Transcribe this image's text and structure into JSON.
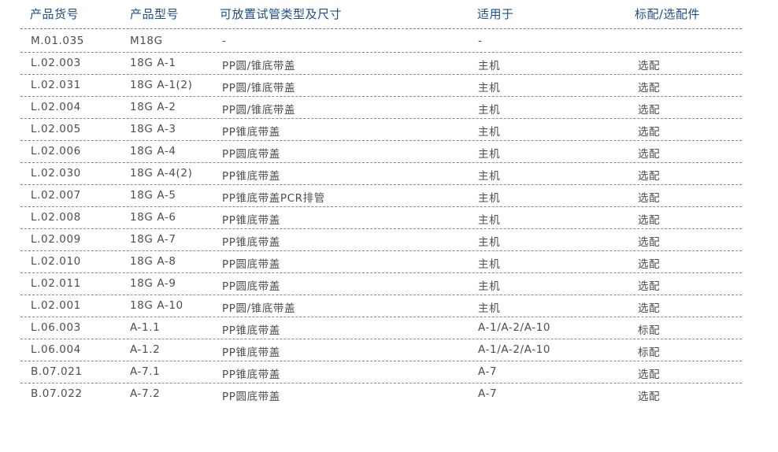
{
  "headers": {
    "code": "产品货号",
    "model": "产品型号",
    "tube": "可放置试管类型及尺寸",
    "applies_to": "适用于",
    "std_opt": "标配/选配件"
  },
  "rows": [
    {
      "code": "M.01.035",
      "model": "M18G",
      "tube": "-",
      "applies_to": "-",
      "std_opt": ""
    },
    {
      "code": "L.02.003",
      "model": "18G A-1",
      "tube": "PP圆/锥底带盖",
      "applies_to": "主机",
      "std_opt": "选配"
    },
    {
      "code": "L.02.031",
      "model": "18G A-1(2)",
      "tube": "PP圆/锥底带盖",
      "applies_to": "主机",
      "std_opt": "选配"
    },
    {
      "code": "L.02.004",
      "model": "18G A-2",
      "tube": "PP圆/锥底带盖",
      "applies_to": "主机",
      "std_opt": "选配"
    },
    {
      "code": "L.02.005",
      "model": "18G A-3",
      "tube": "PP锥底带盖",
      "applies_to": "主机",
      "std_opt": "选配"
    },
    {
      "code": "L.02.006",
      "model": "18G A-4",
      "tube": "PP圆底带盖",
      "applies_to": "主机",
      "std_opt": "选配"
    },
    {
      "code": "L.02.030",
      "model": "18G A-4(2)",
      "tube": "PP锥底带盖",
      "applies_to": "主机",
      "std_opt": "选配"
    },
    {
      "code": "L.02.007",
      "model": "18G A-5",
      "tube": "PP锥底带盖PCR排管",
      "applies_to": "主机",
      "std_opt": "选配"
    },
    {
      "code": "L.02.008",
      "model": "18G A-6",
      "tube": "PP锥底带盖",
      "applies_to": "主机",
      "std_opt": "选配"
    },
    {
      "code": "L.02.009",
      "model": "18G A-7",
      "tube": "PP锥底带盖",
      "applies_to": "主机",
      "std_opt": "选配"
    },
    {
      "code": "L.02.010",
      "model": "18G A-8",
      "tube": "PP圆底带盖",
      "applies_to": "主机",
      "std_opt": "选配"
    },
    {
      "code": "L.02.011",
      "model": "18G A-9",
      "tube": "PP圆底带盖",
      "applies_to": "主机",
      "std_opt": "选配"
    },
    {
      "code": "L.02.001",
      "model": "18G A-10",
      "tube": "PP圆/锥底带盖",
      "applies_to": "主机",
      "std_opt": "选配"
    },
    {
      "code": "L.06.003",
      "model": "A-1.1",
      "tube": "PP锥底带盖",
      "applies_to": "A-1/A-2/A-10",
      "std_opt": "标配"
    },
    {
      "code": "L.06.004",
      "model": "A-1.2",
      "tube": "PP锥底带盖",
      "applies_to": "A-1/A-2/A-10",
      "std_opt": "标配"
    },
    {
      "code": "B.07.021",
      "model": "A-7.1",
      "tube": "PP锥底带盖",
      "applies_to": "A-7",
      "std_opt": "选配"
    },
    {
      "code": "B.07.022",
      "model": "A-7.2",
      "tube": "PP圆底带盖",
      "applies_to": "A-7",
      "std_opt": "选配"
    }
  ]
}
